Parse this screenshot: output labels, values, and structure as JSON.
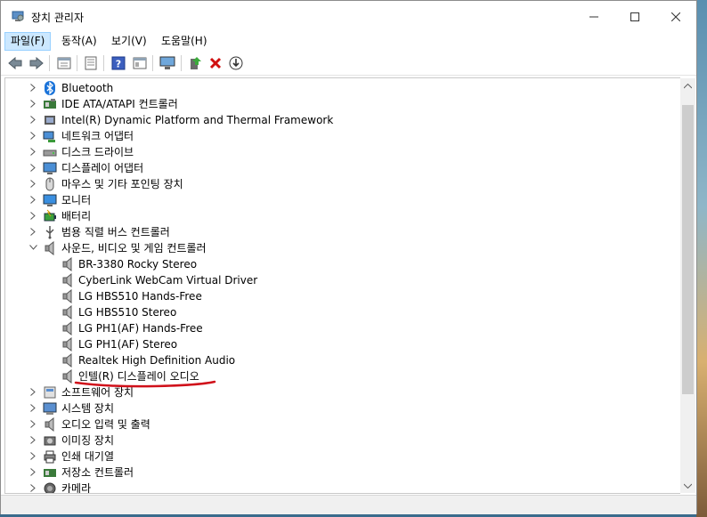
{
  "window": {
    "title": "장치 관리자"
  },
  "menu": [
    {
      "label": "파일(F)",
      "active": true
    },
    {
      "label": "동작(A)"
    },
    {
      "label": "보기(V)"
    },
    {
      "label": "도움말(H)"
    }
  ],
  "toolbar_icons": [
    "back-arrow-icon",
    "forward-arrow-icon",
    "properties-icon",
    "list-icon",
    "help-icon",
    "details-icon",
    "monitor-scan-icon",
    "update-driver-icon",
    "uninstall-icon",
    "download-icon"
  ],
  "tree": {
    "items": [
      {
        "label": "Bluetooth",
        "icon": "bluetooth-icon",
        "expanded": false
      },
      {
        "label": "IDE ATA/ATAPI 컨트롤러",
        "icon": "ide-controller-icon",
        "expanded": false
      },
      {
        "label": "Intel(R) Dynamic Platform and Thermal Framework",
        "icon": "chip-icon",
        "expanded": false
      },
      {
        "label": "네트워크 어댑터",
        "icon": "network-adapter-icon",
        "expanded": false
      },
      {
        "label": "디스크 드라이브",
        "icon": "disk-drive-icon",
        "expanded": false
      },
      {
        "label": "디스플레이 어댑터",
        "icon": "display-adapter-icon",
        "expanded": false
      },
      {
        "label": "마우스 및 기타 포인팅 장치",
        "icon": "mouse-icon",
        "expanded": false
      },
      {
        "label": "모니터",
        "icon": "monitor-icon",
        "expanded": false
      },
      {
        "label": "배터리",
        "icon": "battery-icon",
        "expanded": false
      },
      {
        "label": "범용 직렬 버스 컨트롤러",
        "icon": "usb-icon",
        "expanded": false
      },
      {
        "label": "사운드, 비디오 및 게임 컨트롤러",
        "icon": "speaker-icon",
        "expanded": true
      }
    ],
    "sound_children": [
      "BR-3380 Rocky Stereo",
      "CyberLink WebCam Virtual Driver",
      "LG HBS510 Hands-Free",
      "LG HBS510 Stereo",
      "LG PH1(AF) Hands-Free",
      "LG PH1(AF) Stereo",
      "Realtek High Definition Audio",
      "인텔(R) 디스플레이 오디오"
    ],
    "items_after": [
      {
        "label": "소프트웨어 장치",
        "icon": "software-device-icon"
      },
      {
        "label": "시스템 장치",
        "icon": "system-device-icon"
      },
      {
        "label": "오디오 입력 및 출력",
        "icon": "audio-io-icon"
      },
      {
        "label": "이미징 장치",
        "icon": "imaging-device-icon"
      },
      {
        "label": "인쇄 대기열",
        "icon": "printer-icon"
      },
      {
        "label": "저장소 컨트롤러",
        "icon": "storage-controller-icon"
      },
      {
        "label": "카메라",
        "icon": "camera-icon"
      }
    ]
  },
  "colors": {
    "annotation": "#d0101a",
    "menu_active_bg": "#cce8ff"
  }
}
